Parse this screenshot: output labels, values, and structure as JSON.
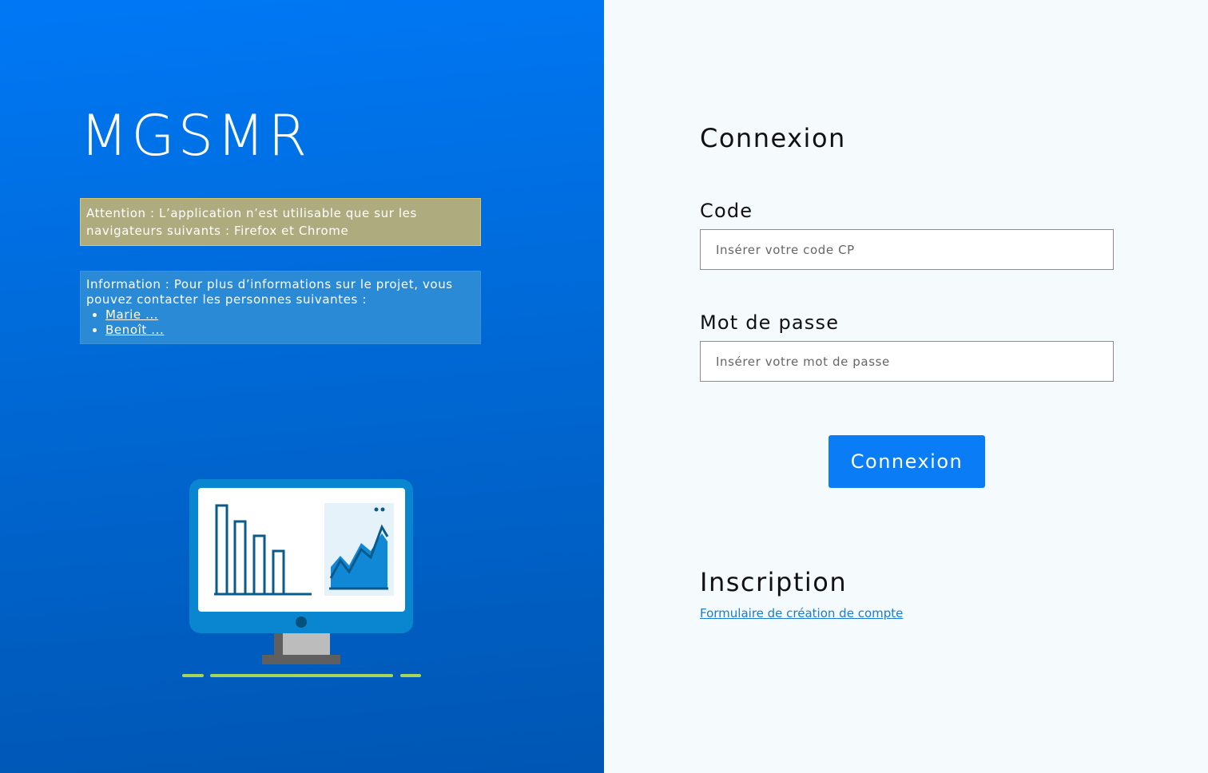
{
  "left": {
    "app_title": "MGSMR",
    "warning": {
      "text": "Attention : L’application n’est utilisable que sur les navigateurs suivants : Firefox et Chrome"
    },
    "info": {
      "text": "Information : Pour plus d’informations sur le projet, vous pouvez contacter les personnes suivantes :",
      "contacts": [
        "Marie ...",
        "Benoît ..."
      ]
    },
    "illustration": {
      "icon": "monitor-dashboard-icon"
    }
  },
  "login": {
    "title": "Connexion",
    "code_label": "Code",
    "code_placeholder": "Insérer votre code CP",
    "code_value": "",
    "password_label": "Mot de passe",
    "password_placeholder": "Insérer votre mot de passe",
    "password_value": "",
    "submit_label": "Connexion"
  },
  "signup": {
    "title": "Inscription",
    "link_label": "Formulaire de création de compte"
  },
  "colors": {
    "primary_blue": "#0a7cf6",
    "warning_bg": "#aeab7f",
    "info_bg": "#2a8ad6",
    "link": "#1a7bd4",
    "right_bg": "#f5fafd"
  }
}
